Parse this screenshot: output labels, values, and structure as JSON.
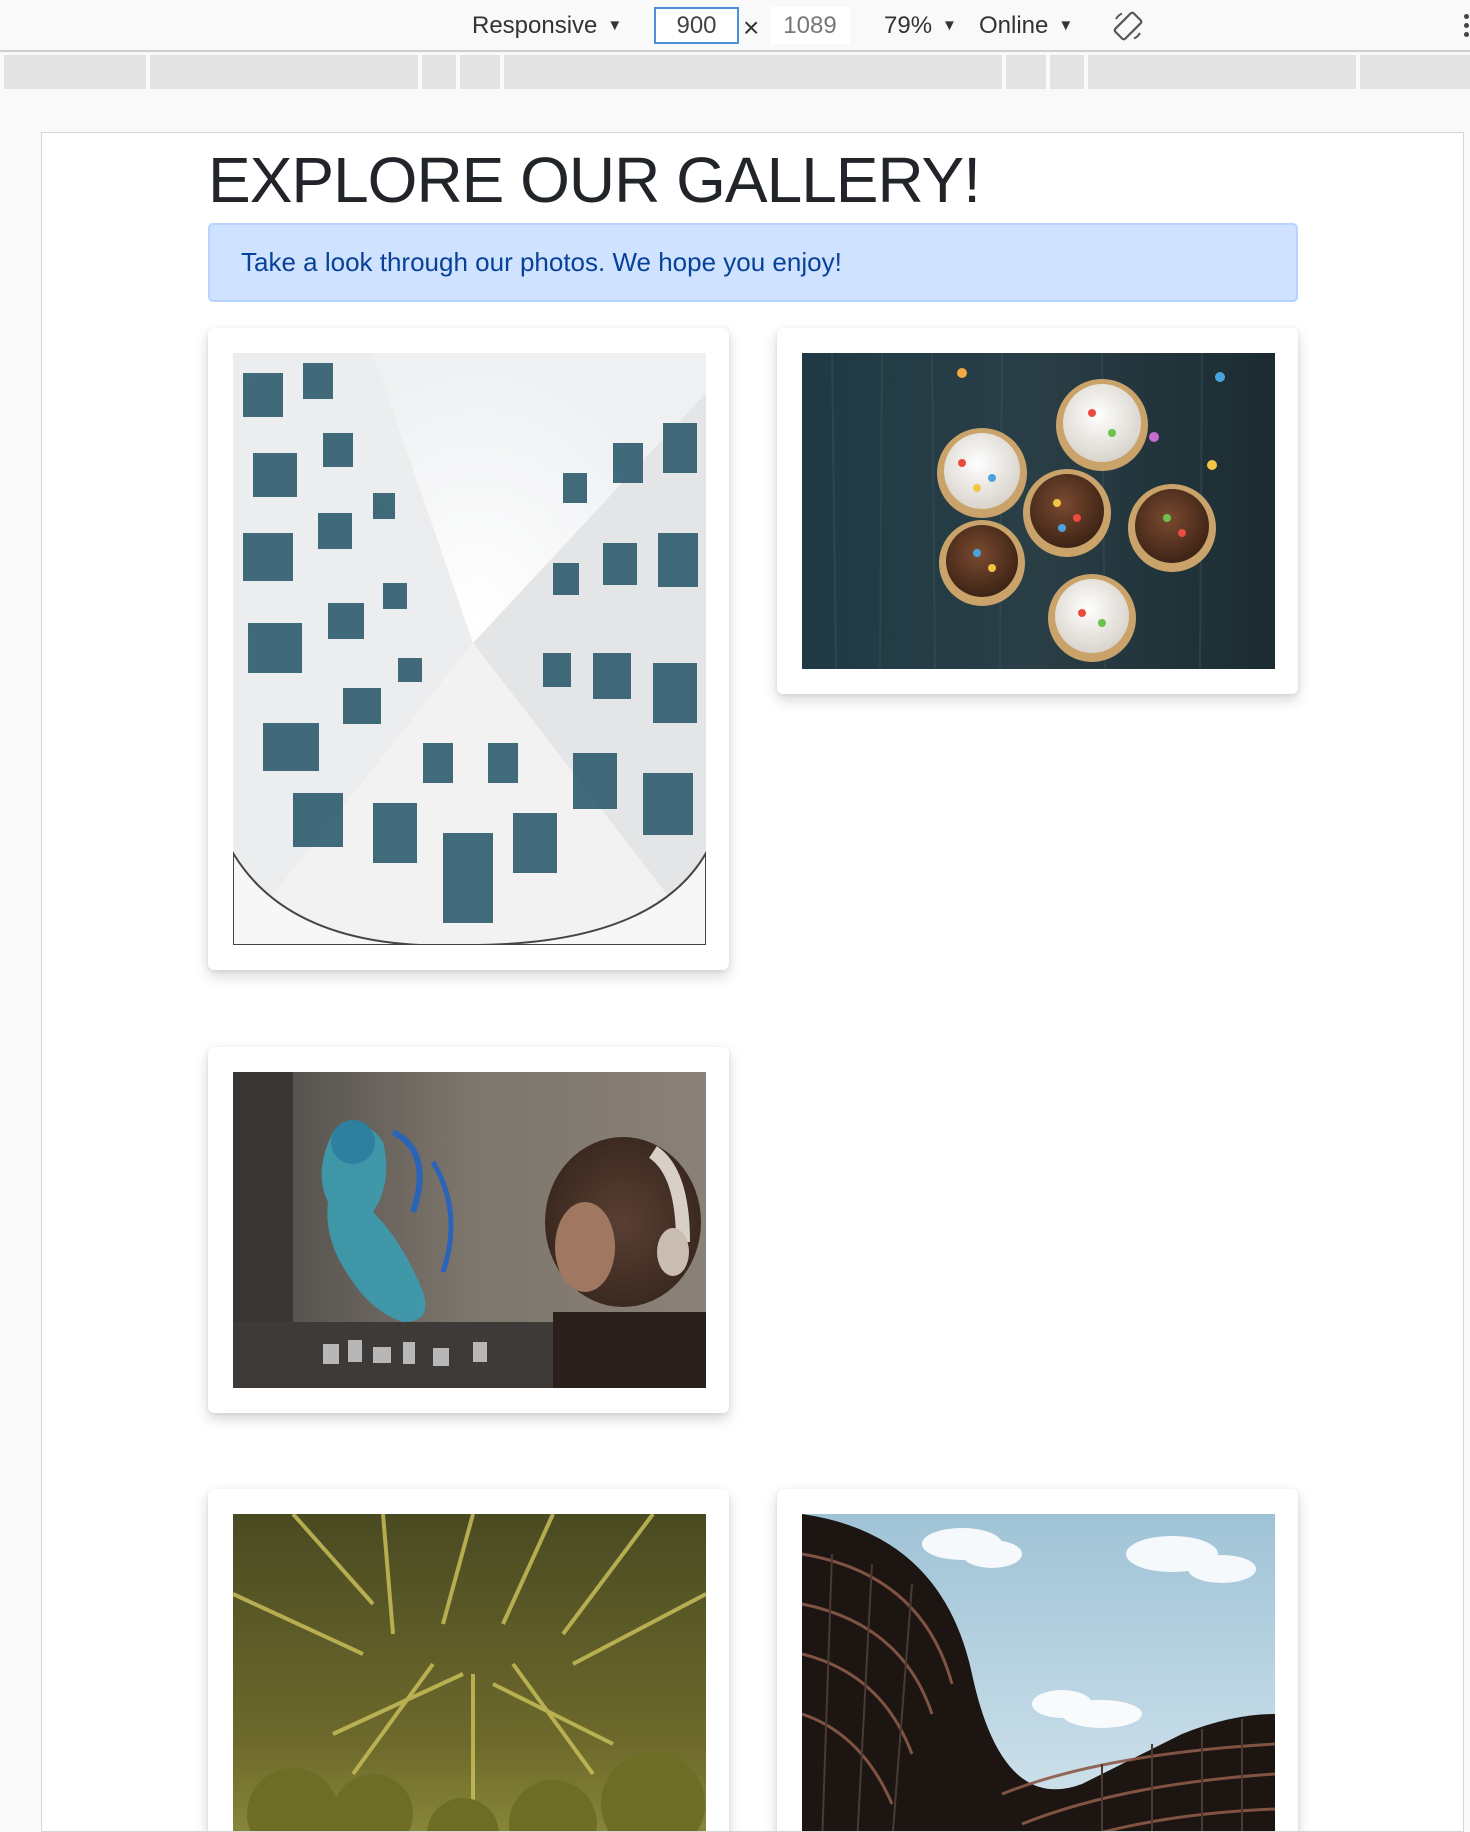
{
  "toolbar": {
    "device_label": "Responsive",
    "width_value": "900",
    "height_value": "1089",
    "zoom_label": "79%",
    "network_label": "Online"
  },
  "page": {
    "title": "EXPLORE OUR GALLERY!",
    "alert_text": "Take a look through our photos. We hope you enjoy!"
  },
  "colors": {
    "alert_bg": "#cfe2ff",
    "alert_text": "#084298",
    "input_focus": "#4a90d9"
  },
  "gallery": {
    "images": [
      {
        "subject": "building-courtyard-upward-view"
      },
      {
        "subject": "cupcakes-on-dark-wood"
      },
      {
        "subject": "street-art-and-person-with-headphones"
      },
      {
        "subject": "palm-trees-from-below"
      },
      {
        "subject": "curved-modern-building"
      }
    ]
  }
}
